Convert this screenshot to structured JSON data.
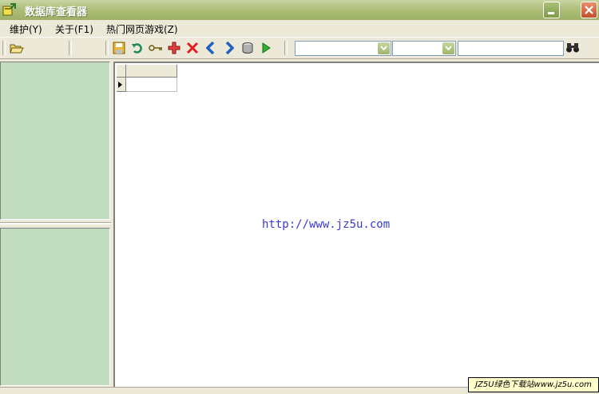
{
  "window": {
    "title": "数据库查看器"
  },
  "menu": {
    "items": [
      {
        "label": "维护(Y)"
      },
      {
        "label": "关于(F1)"
      },
      {
        "label": "热门网页游戏(Z)"
      }
    ]
  },
  "toolbar": {
    "buttons": [
      {
        "icon": "open-folder-icon"
      },
      {
        "icon": "save-icon"
      },
      {
        "icon": "undo-icon"
      },
      {
        "icon": "key-icon"
      },
      {
        "icon": "add-icon"
      },
      {
        "icon": "delete-icon"
      },
      {
        "icon": "previous-icon"
      },
      {
        "icon": "next-icon"
      },
      {
        "icon": "database-icon"
      },
      {
        "icon": "run-icon"
      },
      {
        "icon": "binoculars-icon"
      }
    ],
    "combo1_value": "",
    "combo2_value": "",
    "search_value": ""
  },
  "grid": {
    "watermark": "http://www.jz5u.com"
  },
  "badge": {
    "text": "JZ5U绿色下载站www.jz5u.com"
  },
  "colors": {
    "title_bar": "#aebf79",
    "left_panel": "#c2dcc0",
    "close_button": "#d0603a",
    "link_text": "#3a3acc"
  }
}
